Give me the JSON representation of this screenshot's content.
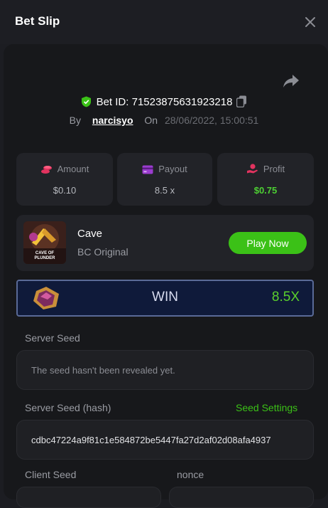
{
  "header": {
    "title": "Bet Slip"
  },
  "bet": {
    "id_text": "Bet ID: 71523875631923218",
    "by_label": "By",
    "user": "narcisyo",
    "on_label": "On",
    "date": "28/06/2022, 15:00:51"
  },
  "stats": [
    {
      "label": "Amount",
      "value": "$0.10",
      "icon": "coins-icon"
    },
    {
      "label": "Payout",
      "value": "8.5 x",
      "icon": "card-icon"
    },
    {
      "label": "Profit",
      "value": "$0.75",
      "icon": "hand-coin-icon"
    }
  ],
  "game": {
    "thumb_caption": "CAVE OF PLUNDER",
    "name": "Cave",
    "subtitle": "BC Original",
    "play_label": "Play Now"
  },
  "result": {
    "text": "WIN",
    "multiplier": "8.5X"
  },
  "server_seed": {
    "label": "Server Seed",
    "value": "The seed hasn't been revealed yet."
  },
  "server_seed_hash": {
    "label": "Server Seed (hash)",
    "link": "Seed Settings",
    "value": "cdbc47224a9f81c1e584872be5447fa27d2af02d08afa4937"
  },
  "client_seed": {
    "label": "Client Seed"
  },
  "nonce": {
    "label": "nonce"
  },
  "colors": {
    "accent": "#3bc117",
    "profit": "#4dd133",
    "background": "#17181b"
  }
}
